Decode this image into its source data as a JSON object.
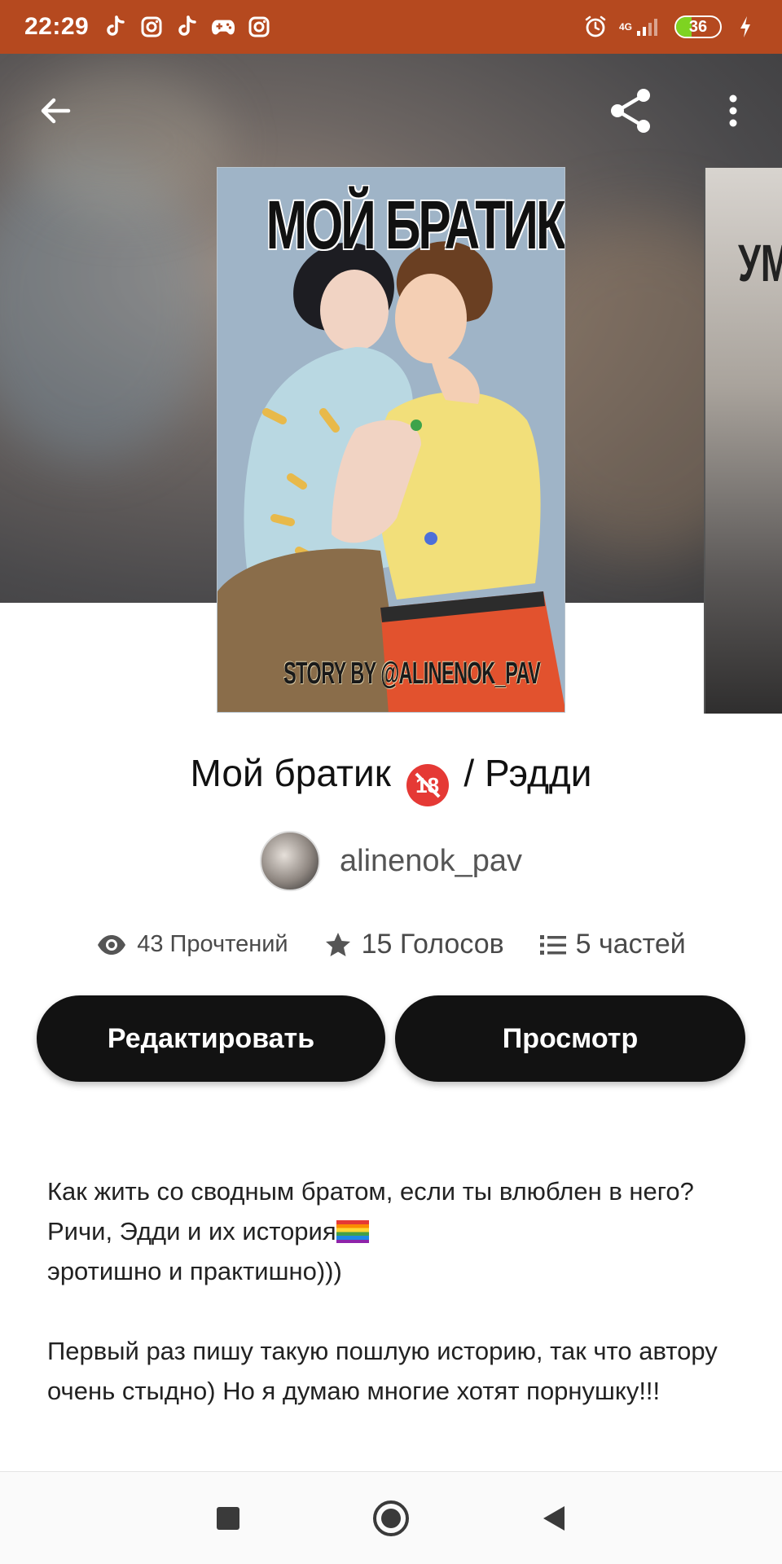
{
  "status_bar": {
    "time": "22:29",
    "network": "4G",
    "battery": "36",
    "battery_level": 0.36,
    "app_icons": [
      "tiktok-icon",
      "instagram-icon",
      "tiktok-icon",
      "gamepad-icon",
      "instagram-icon"
    ]
  },
  "header": {
    "back_icon": "arrow-left-icon",
    "share_icon": "share-icon",
    "menu_icon": "more-vertical-icon"
  },
  "cover": {
    "title_text": "МОЙ БРАТИК",
    "byline_text": "STORY BY @ALINENOK_PAV",
    "next_cover_text": "УМ"
  },
  "story": {
    "title_part1": "Мой братик",
    "age_badge": "18",
    "title_part2": "/ Рэдди",
    "author": "alinenok_pav"
  },
  "stats": {
    "reads": "43 Прочтений",
    "votes": "15 Голосов",
    "parts": "5 частей"
  },
  "actions": {
    "edit": "Редактировать",
    "view": "Просмотр"
  },
  "description": {
    "line1": "Как жить со сводным братом, если ты влюблен в него? Ричи, Эдди и их история",
    "line2": "эротишно и практишно)))",
    "paragraph2": "Первый раз пишу такую пошлую историю, так что автору очень стыдно) Но я думаю многие хотят порнушку!!!"
  },
  "colors": {
    "status_bar": "#b5491f",
    "button_bg": "#121212",
    "battery_fill": "#7ed321"
  }
}
